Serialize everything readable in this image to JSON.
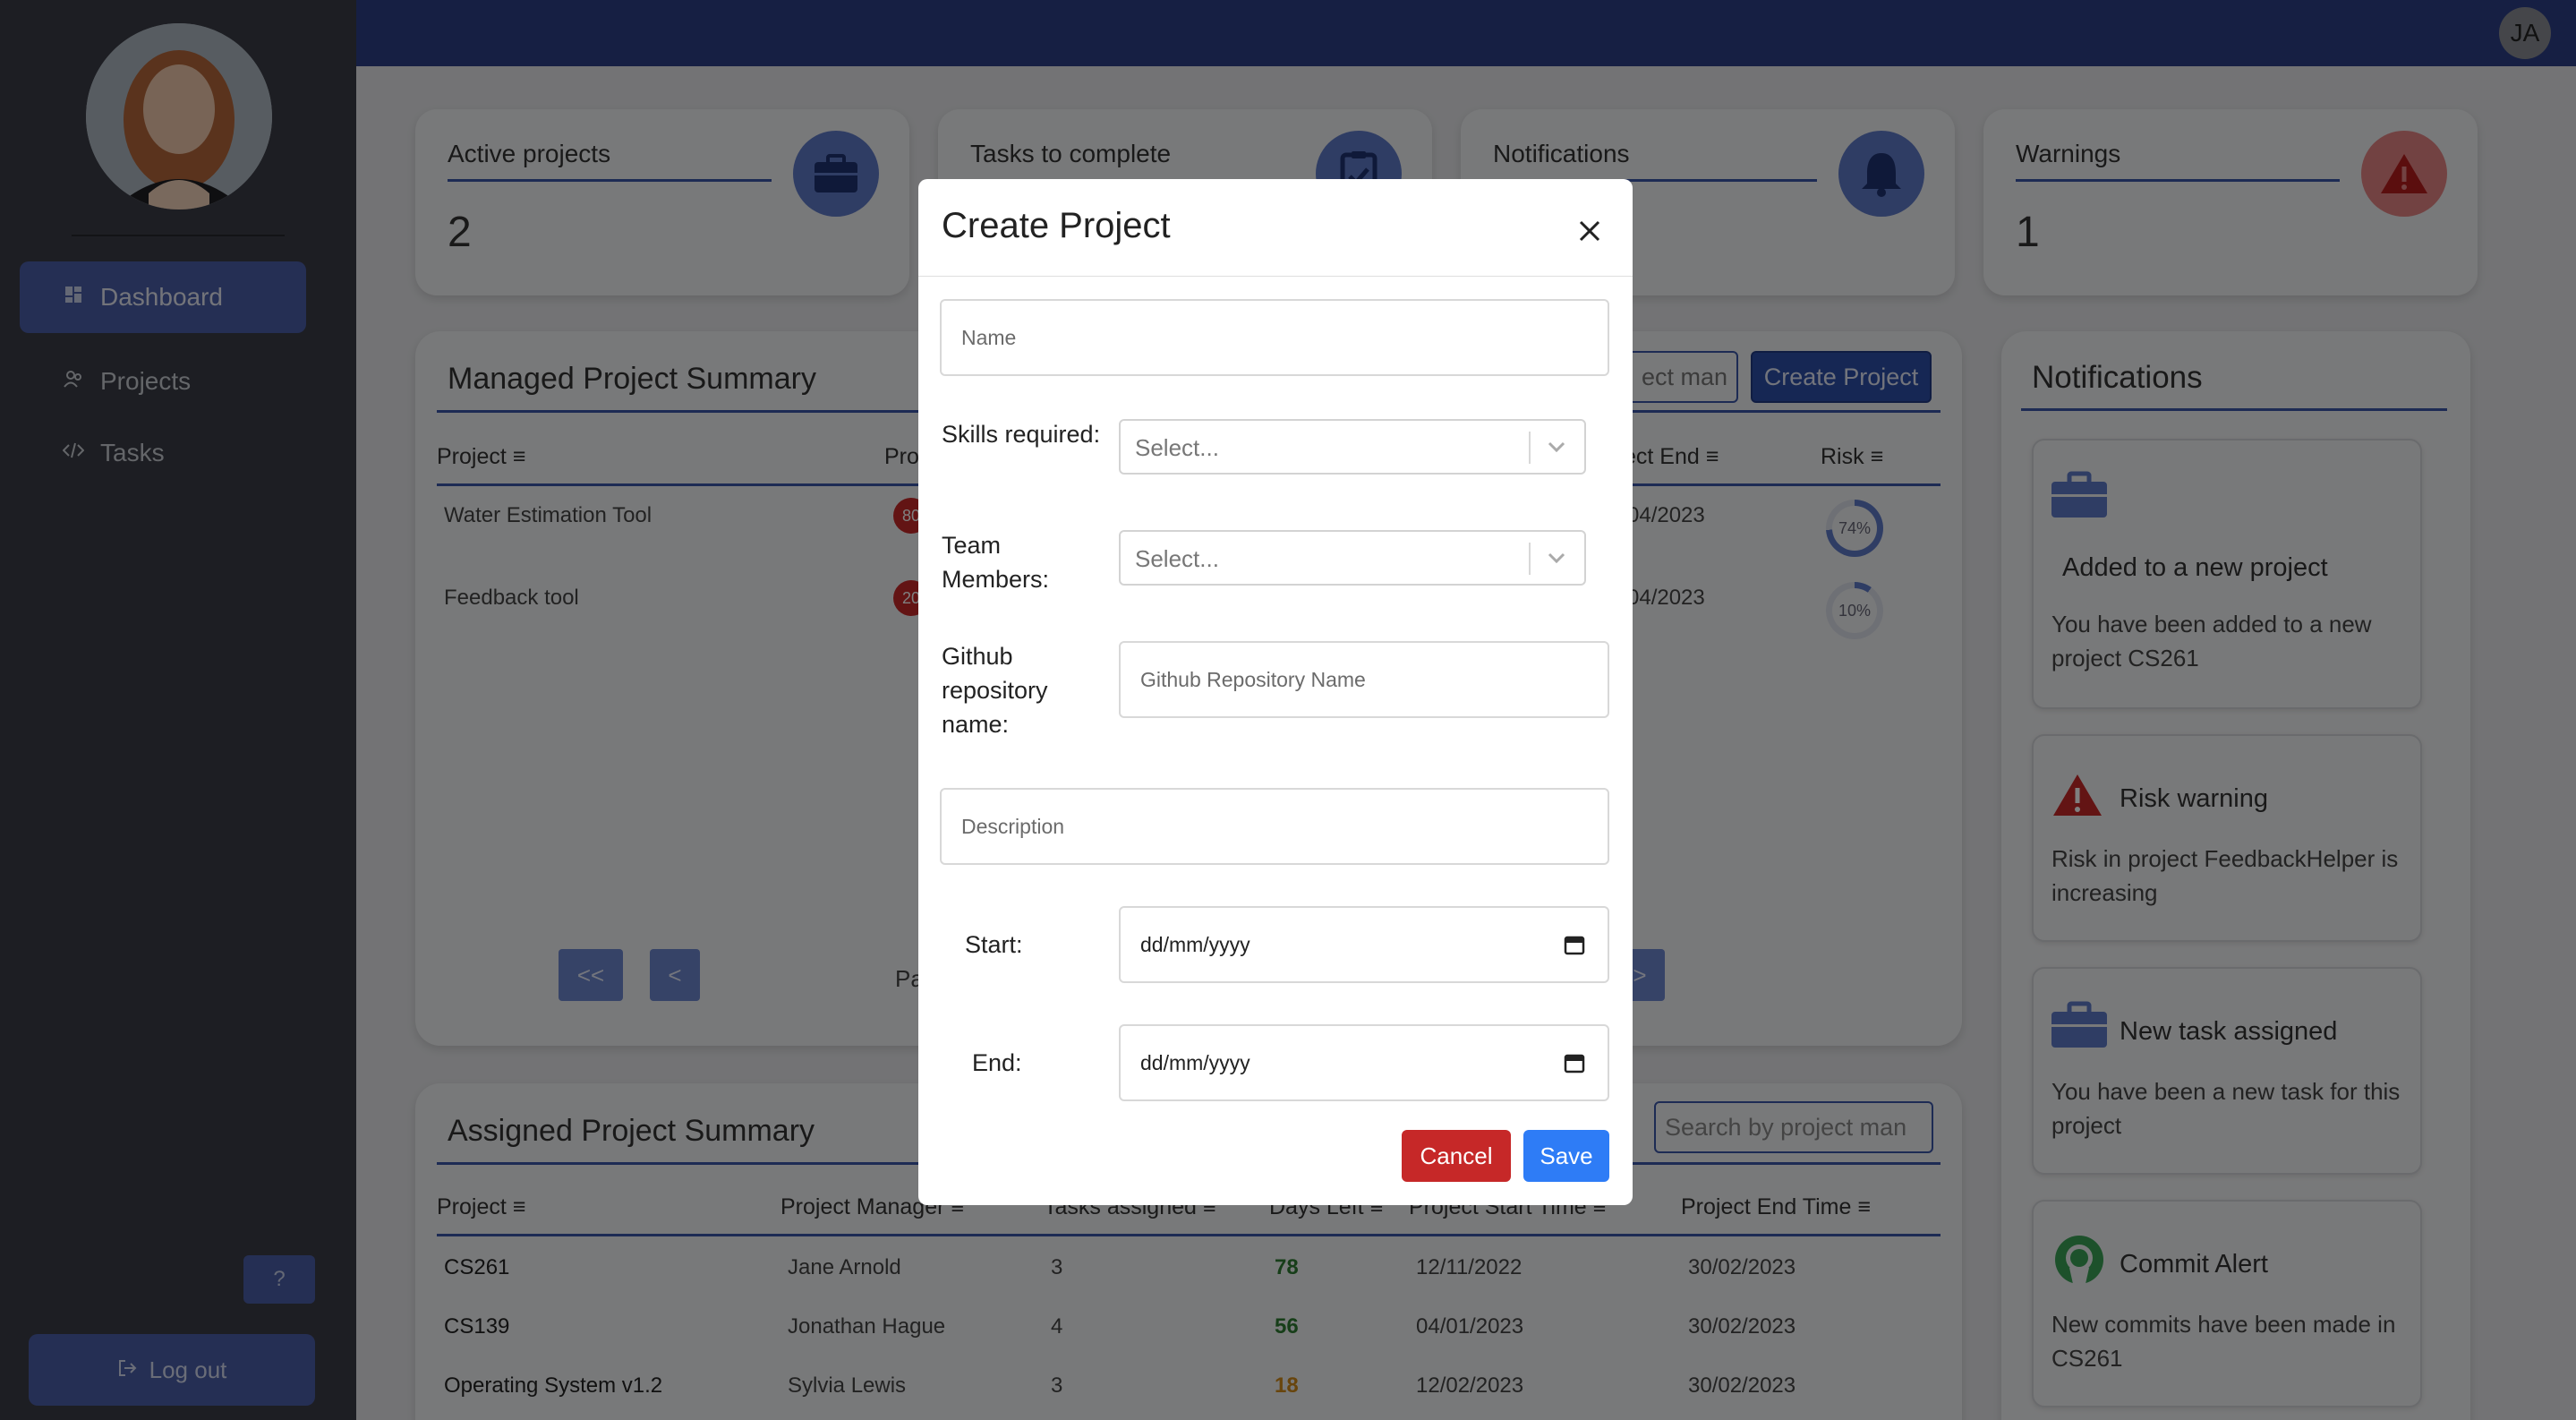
{
  "sidebar": {
    "items": [
      {
        "label": "Dashboard",
        "icon": "dashboard-icon"
      },
      {
        "label": "Projects",
        "icon": "people-icon"
      },
      {
        "label": "Tasks",
        "icon": "code-icon"
      }
    ],
    "help_label": "?",
    "logout_label": "Log out"
  },
  "topbar": {
    "user_initials": "JA"
  },
  "stats": [
    {
      "label": "Active projects",
      "value": "2",
      "icon": "briefcase-icon"
    },
    {
      "label": "Tasks to complete",
      "value": "",
      "icon": "clipboard-check-icon"
    },
    {
      "label": "Notifications",
      "value": "",
      "icon": "bell-icon"
    },
    {
      "label": "Warnings",
      "value": "1",
      "icon": "warning-icon"
    }
  ],
  "managed": {
    "title": "Managed Project Summary",
    "search_fragment": "ect man",
    "create_label": "Create Project",
    "headers": {
      "project": "Project",
      "progress": "Pro",
      "end": "ect End",
      "risk": "Risk"
    },
    "rows": [
      {
        "project": "Water Estimation Tool",
        "progress": "80",
        "end": "04/2023",
        "risk": "74%",
        "risk_value": 74
      },
      {
        "project": "Feedback tool",
        "progress": "20",
        "end": "04/2023",
        "risk": "10%",
        "risk_value": 10
      }
    ],
    "pagination": {
      "first": "<<",
      "prev": "<",
      "page_fragment": "Pa",
      "next": ">"
    }
  },
  "assigned": {
    "title": "Assigned Project Summary",
    "search_placeholder": "Search by project man",
    "headers": [
      "Project",
      "Project Manager",
      "Tasks assigned",
      "Days Left",
      "Project Start Time",
      "Project End Time"
    ],
    "rows": [
      {
        "project": "CS261",
        "manager": "Jane Arnold",
        "tasks": "3",
        "days": "78",
        "start": "12/11/2022",
        "end": "30/02/2023",
        "days_color": "#2e7d32"
      },
      {
        "project": "CS139",
        "manager": "Jonathan Hague",
        "tasks": "4",
        "days": "56",
        "start": "04/01/2023",
        "end": "30/02/2023",
        "days_color": "#2e7d32"
      },
      {
        "project": "Operating System v1.2",
        "manager": "Sylvia Lewis",
        "tasks": "3",
        "days": "18",
        "start": "12/02/2023",
        "end": "30/02/2023",
        "days_color": "#d08b1a"
      }
    ]
  },
  "notifications": {
    "title": "Notifications",
    "items": [
      {
        "title": "Added to a new project",
        "body": "You have been added to a new project CS261",
        "icon": "briefcase-icon"
      },
      {
        "title": "Risk warning",
        "body": "Risk in project FeedbackHelper is increasing",
        "icon": "warning-icon"
      },
      {
        "title": "New task assigned",
        "body": "You have been a new task for this project",
        "icon": "briefcase-icon"
      },
      {
        "title": "Commit Alert",
        "body": "New commits have been made in CS261",
        "icon": "github-icon"
      }
    ]
  },
  "modal": {
    "title": "Create Project",
    "name_placeholder": "Name",
    "skills_label": "Skills required:",
    "skills_placeholder": "Select...",
    "team_label": "Team Members:",
    "team_placeholder": "Select...",
    "github_label": "Github repository name:",
    "github_placeholder": "Github Repository Name",
    "description_placeholder": "Description",
    "start_label": "Start:",
    "start_value": "dd/mm/yyyy",
    "end_label": "End:",
    "end_value": "dd/mm/yyyy",
    "cancel_label": "Cancel",
    "save_label": "Save"
  },
  "colors": {
    "accent": "#3a56a8",
    "topbar": "#2d3f86",
    "sidebar": "#3a3d47",
    "cancel": "#c62828",
    "save": "#2e7cf6"
  }
}
